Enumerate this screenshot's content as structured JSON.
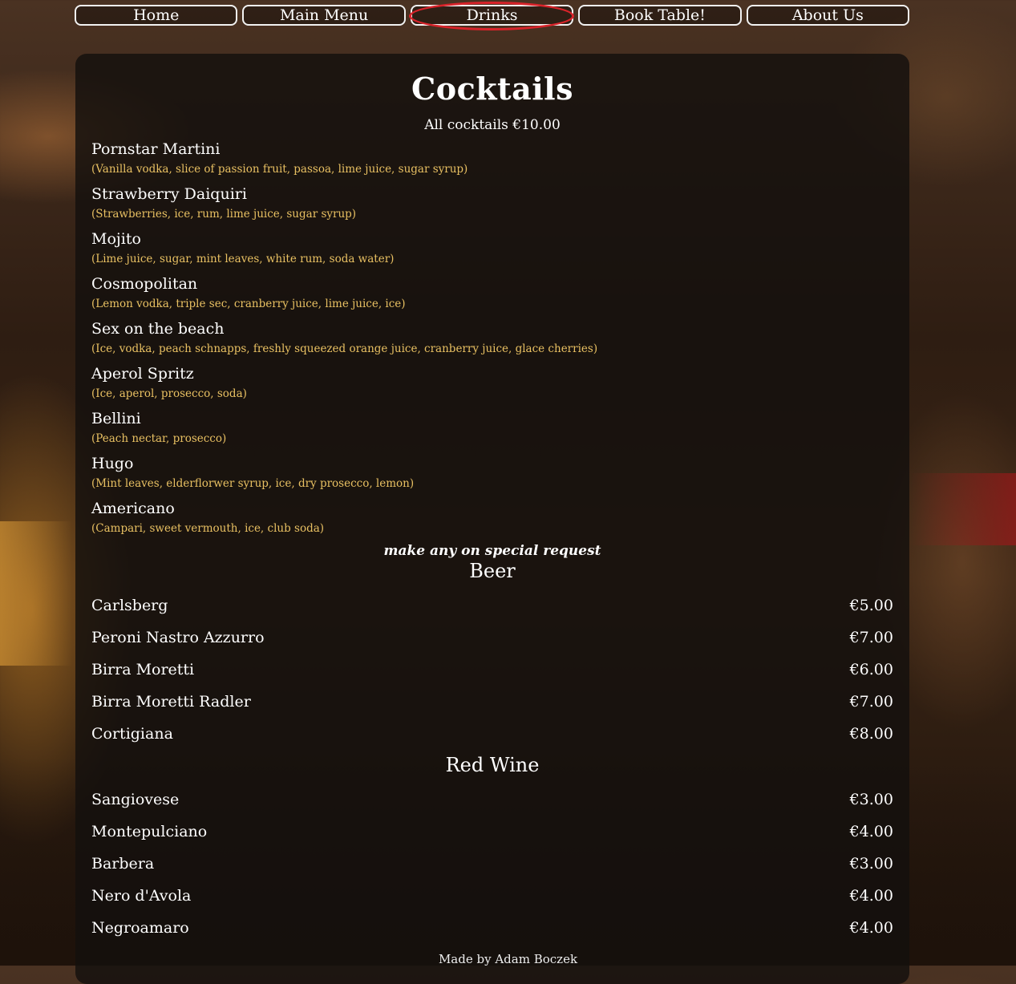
{
  "nav": {
    "items": [
      {
        "label": "Home"
      },
      {
        "label": "Main Menu"
      },
      {
        "label": "Drinks"
      },
      {
        "label": "Book Table!"
      },
      {
        "label": "About Us"
      }
    ],
    "active": "Drinks"
  },
  "cocktails": {
    "title": "Cocktails",
    "subtitle": "All cocktails €10.00",
    "items": [
      {
        "name": "Pornstar Martini",
        "ingredients": "(Vanilla vodka, slice of passion fruit, passoa, lime juice, sugar syrup)"
      },
      {
        "name": "Strawberry Daiquiri",
        "ingredients": "(Strawberries, ice, rum, lime juice, sugar syrup)"
      },
      {
        "name": "Mojito",
        "ingredients": "(Lime juice, sugar, mint leaves, white rum, soda water)"
      },
      {
        "name": "Cosmopolitan",
        "ingredients": "(Lemon vodka, triple sec, cranberry juice, lime juice, ice)"
      },
      {
        "name": "Sex on the beach",
        "ingredients": "(Ice, vodka, peach schnapps, freshly squeezed orange juice, cranberry juice, glace cherries)"
      },
      {
        "name": "Aperol Spritz",
        "ingredients": "(Ice, aperol, prosecco, soda)"
      },
      {
        "name": "Bellini",
        "ingredients": "(Peach nectar, prosecco)"
      },
      {
        "name": "Hugo",
        "ingredients": "(Mint leaves, elderflorwer syrup, ice, dry prosecco, lemon)"
      },
      {
        "name": "Americano",
        "ingredients": "(Campari, sweet vermouth, ice, club soda)"
      }
    ],
    "note": "make any on special request"
  },
  "beer": {
    "title": "Beer",
    "items": [
      {
        "name": "Carlsberg",
        "price": "€5.00"
      },
      {
        "name": "Peroni Nastro Azzurro",
        "price": "€7.00"
      },
      {
        "name": "Birra Moretti",
        "price": "€6.00"
      },
      {
        "name": "Birra Moretti Radler",
        "price": "€7.00"
      },
      {
        "name": "Cortigiana",
        "price": "€8.00"
      }
    ]
  },
  "red_wine": {
    "title": "Red Wine",
    "items": [
      {
        "name": "Sangiovese",
        "price": "€3.00"
      },
      {
        "name": "Montepulciano",
        "price": "€4.00"
      },
      {
        "name": "Barbera",
        "price": "€3.00"
      },
      {
        "name": "Nero d'Avola",
        "price": "€4.00"
      },
      {
        "name": "Negroamaro",
        "price": "€4.00"
      }
    ]
  },
  "footer": {
    "text": "Made by Adam Boczek"
  },
  "colors": {
    "accent_ingredients": "#e8c062",
    "annotation_circle": "#d8232a"
  }
}
